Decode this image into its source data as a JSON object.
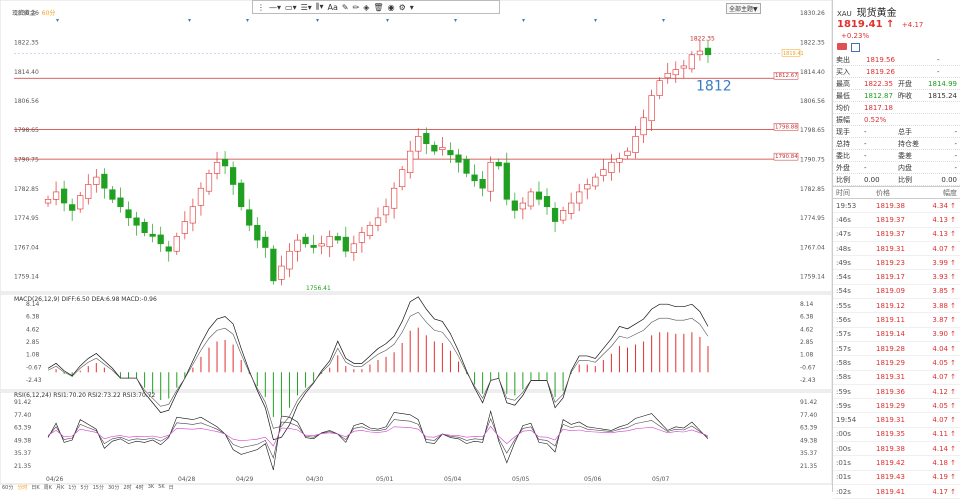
{
  "app": {
    "title_text": "现货黄金",
    "period_suffix": "60分"
  },
  "toolbar": {
    "font_label": "Aa"
  },
  "topright": {
    "button_label": "全部主题▼"
  },
  "chart_data": [
    {
      "type": "candlestick",
      "title": "现货黄金",
      "ylim": [
        1755,
        1830
      ],
      "y_ticks": [
        "1830.26",
        "1822.35",
        "1814.40",
        "1806.56",
        "1798.65",
        "1790.75",
        "1782.85",
        "1774.95",
        "1767.04",
        "1759.14"
      ],
      "x_ticks": [
        "04/26",
        "04/28",
        "04/29",
        "04/30",
        "05/01",
        "05/04",
        "05/05",
        "05/06",
        "05/07"
      ],
      "hlines": [
        {
          "value": 1812.67,
          "label": "1812.67"
        },
        {
          "value": 1798.88,
          "label": "1798.88"
        },
        {
          "value": 1790.84,
          "label": "1790.84"
        }
      ],
      "annotations": [
        {
          "label": "1812",
          "value": 1812
        },
        {
          "label": "1822.35",
          "value": 1822.35
        },
        {
          "label": "1756.41",
          "value": 1756.41
        }
      ],
      "last_price": "1819.41",
      "close": [
        1780,
        1782,
        1779,
        1777,
        1781,
        1784,
        1786,
        1783,
        1780,
        1778,
        1775,
        1773,
        1771,
        1770,
        1768,
        1766,
        1770,
        1774,
        1778,
        1783,
        1787,
        1790,
        1789,
        1784,
        1778,
        1773,
        1769,
        1767,
        1758,
        1762,
        1766,
        1769,
        1768,
        1767,
        1768,
        1770,
        1769,
        1766,
        1768,
        1771,
        1773,
        1775,
        1778,
        1783,
        1788,
        1793,
        1797,
        1795,
        1793,
        1794,
        1792,
        1790,
        1787,
        1785,
        1783,
        1790,
        1789,
        1780,
        1777,
        1779,
        1782,
        1780,
        1778,
        1774,
        1777,
        1779,
        1782,
        1784,
        1786,
        1788,
        1790,
        1791,
        1793,
        1797,
        1802,
        1808,
        1812,
        1814,
        1815,
        1816,
        1819,
        1820,
        1819
      ]
    },
    {
      "type": "macd",
      "title": "MACD(26,12,9)",
      "values_label": {
        "diff": "DIFF:6.50",
        "dea": "DEA:6.98",
        "macd": "MACD:-0.96"
      },
      "y_ticks": [
        "8.14",
        "6.38",
        "4.62",
        "2.85",
        "1.08",
        "-0.67",
        "-2.43"
      ]
    },
    {
      "type": "rsi",
      "title": "RSI(6,12,24)",
      "values_label": {
        "rsi1": "RSI1:70.20",
        "rsi2": "RSI2:73.22",
        "rsi3": "RSI3:70.72"
      },
      "y_ticks": [
        "91.42",
        "77.40",
        "63.39",
        "49.38",
        "35.37",
        "21.35"
      ]
    }
  ],
  "quote": {
    "symbol": "XAU",
    "name": "现货黄金",
    "price": "1819.41",
    "arrow": "↑",
    "change": "+4.17",
    "pct": "+0.23%",
    "sell_label": "卖出",
    "sell": "1819.56",
    "buy_label": "买入",
    "buy": "1819.26",
    "stats": [
      {
        "l1": "最高",
        "v1": "1822.35",
        "l2": "开盘",
        "v2": "1814.99"
      },
      {
        "l1": "最低",
        "v1": "1812.87",
        "l2": "昨收",
        "v2": "1815.24"
      },
      {
        "l1": "均价",
        "v1": "1817.18",
        "l2": "",
        "v2": ""
      },
      {
        "l1": "振幅",
        "v1": "0.52%",
        "l2": "",
        "v2": ""
      },
      {
        "l1": "现手",
        "v1": "-",
        "l2": "总手",
        "v2": "-"
      },
      {
        "l1": "总持",
        "v1": "-",
        "l2": "持仓差",
        "v2": "-"
      },
      {
        "l1": "委比",
        "v1": "-",
        "l2": "委差",
        "v2": "-"
      },
      {
        "l1": "外盘",
        "v1": "-",
        "l2": "内盘",
        "v2": "-"
      },
      {
        "l1": "比例",
        "v1": "0.00",
        "l2": "比例",
        "v2": "0.00"
      }
    ],
    "tick_headers": [
      "时间",
      "价格",
      "幅度"
    ],
    "ticks": [
      {
        "t": "19:53",
        "p": "1819.38",
        "v": "4.34"
      },
      {
        "t": ":46s",
        "p": "1819.37",
        "v": "4.13"
      },
      {
        "t": ":47s",
        "p": "1819.37",
        "v": "4.13"
      },
      {
        "t": ":48s",
        "p": "1819.31",
        "v": "4.07"
      },
      {
        "t": ":49s",
        "p": "1819.23",
        "v": "3.99"
      },
      {
        "t": ":54s",
        "p": "1819.17",
        "v": "3.93"
      },
      {
        "t": ":54s",
        "p": "1819.09",
        "v": "3.85"
      },
      {
        "t": ":55s",
        "p": "1819.12",
        "v": "3.88"
      },
      {
        "t": ":56s",
        "p": "1819.11",
        "v": "3.87"
      },
      {
        "t": ":57s",
        "p": "1819.14",
        "v": "3.90"
      },
      {
        "t": ":57s",
        "p": "1819.28",
        "v": "4.04"
      },
      {
        "t": ":58s",
        "p": "1819.29",
        "v": "4.05"
      },
      {
        "t": ":58s",
        "p": "1819.31",
        "v": "4.07"
      },
      {
        "t": ":59s",
        "p": "1819.36",
        "v": "4.12"
      },
      {
        "t": ":59s",
        "p": "1819.29",
        "v": "4.05"
      },
      {
        "t": "19:54",
        "p": "1819.31",
        "v": "4.07"
      },
      {
        "t": ":00s",
        "p": "1819.35",
        "v": "4.11"
      },
      {
        "t": ":00s",
        "p": "1819.38",
        "v": "4.14"
      },
      {
        "t": ":01s",
        "p": "1819.42",
        "v": "4.18"
      },
      {
        "t": ":01s",
        "p": "1819.43",
        "v": "4.19"
      },
      {
        "t": ":02s",
        "p": "1819.41",
        "v": "4.17"
      }
    ]
  },
  "tabs": [
    "60分",
    "分时",
    "日K",
    "周K",
    "月K",
    "1分",
    "5分",
    "15分",
    "30分",
    "2时",
    "4时",
    "3K",
    "5K",
    "日"
  ],
  "colors": {
    "up": "#e03030",
    "down": "#20a020",
    "hline": "#c83030",
    "accent": "#f0a020"
  }
}
